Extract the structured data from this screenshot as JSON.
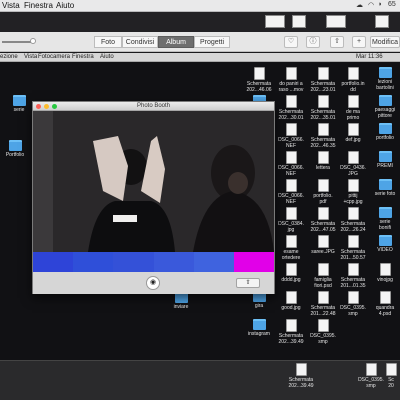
{
  "menubar": {
    "items": [
      "Vista",
      "Finestra",
      "Aiuto"
    ],
    "battery": "65"
  },
  "toolbar": {
    "tabs": [
      "Foto",
      "Condivisi",
      "Album",
      "Progetti"
    ],
    "active_tab": "Album",
    "edit_label": "Modifica"
  },
  "finder_menu": [
    "ezione",
    "Vista",
    "Fotocamera",
    "Finestra",
    "Aiuto"
  ],
  "finder_time": "Mar 11:36",
  "photobooth": {
    "title": "Photo Booth",
    "swatch_colors": [
      "#2e44d8",
      "#2f4fd9",
      "#3451d8",
      "#3a59db",
      "#3f63df",
      "#e100e8"
    ],
    "share_label": "⇧"
  },
  "desktop_left": [
    {
      "label": "serie",
      "type": "folder"
    },
    {
      "label": "Portfolio",
      "type": "folder"
    },
    {
      "label": "inviare",
      "type": "folder"
    }
  ],
  "desktop_items": [
    {
      "label": "Schermata\n202...46.06",
      "type": "file"
    },
    {
      "label": "do paniri a\nraso ...mov",
      "type": "file"
    },
    {
      "label": "Schermata\n202...23.01",
      "type": "file"
    },
    {
      "label": "portfolio.in\ndd",
      "type": "file"
    },
    {
      "label": "lezioni\nbartolini",
      "type": "folder"
    },
    {
      "label": "ARTISTI",
      "type": "folder"
    },
    {
      "label": "Schermata\n202...30.01",
      "type": "file"
    },
    {
      "label": "Schermata\n202...35.01",
      "type": "file"
    },
    {
      "label": "de ma\nprimo",
      "type": "file"
    },
    {
      "label": "paesaggi\npittore",
      "type": "folder"
    },
    {
      "label": "cacciona",
      "type": "folder"
    },
    {
      "label": "DSC_0066.\nNEF",
      "type": "file"
    },
    {
      "label": "Schermata\n202...46.35",
      "type": "file"
    },
    {
      "label": "def.jpg",
      "type": "file"
    },
    {
      "label": "portfolio",
      "type": "folder"
    },
    {
      "label": "capanna",
      "type": "folder"
    },
    {
      "label": "DSC_0066.\nNEF",
      "type": "file"
    },
    {
      "label": "lettera",
      "type": "file"
    },
    {
      "label": "DSC_0436.\nJPG",
      "type": "file"
    },
    {
      "label": "PREMI",
      "type": "folder"
    },
    {
      "label": "concorsi\nrinnovati",
      "type": "folder"
    },
    {
      "label": "DSC_0066.\nNEF",
      "type": "file"
    },
    {
      "label": "portfolio.\npdf",
      "type": "file"
    },
    {
      "label": "pittij\n+cpp.jpg",
      "type": "file"
    },
    {
      "label": "serie foto",
      "type": "folder"
    },
    {
      "label": "da stampare",
      "type": "folder"
    },
    {
      "label": "DSC_0384.\njpg",
      "type": "file"
    },
    {
      "label": "Schermata\n202...47.05",
      "type": "file"
    },
    {
      "label": "Schermata\n202...26.24",
      "type": "file"
    },
    {
      "label": "serie\nbonifi",
      "type": "folder"
    },
    {
      "label": "DESKTOP",
      "type": "folder"
    },
    {
      "label": "esame\nortedere",
      "type": "file"
    },
    {
      "label": "saree.JPG",
      "type": "file"
    },
    {
      "label": "Schermata\n201...50.57",
      "type": "file"
    },
    {
      "label": "VIDEO",
      "type": "folder"
    },
    {
      "label": "foto",
      "type": "folder"
    },
    {
      "label": "dddd.jpg",
      "type": "file"
    },
    {
      "label": "famiglia\nfiori.psd",
      "type": "file"
    },
    {
      "label": "Schermata\n201...01.35",
      "type": "file"
    },
    {
      "label": "vinojpg",
      "type": "file"
    },
    {
      "label": "gira",
      "type": "folder"
    },
    {
      "label": "good.jpg",
      "type": "file"
    },
    {
      "label": "Schermata\n201...22.48",
      "type": "file"
    },
    {
      "label": "DSC_0395.\nsmp",
      "type": "file"
    },
    {
      "label": "quandra\n4.psd",
      "type": "file"
    },
    {
      "label": "instagram",
      "type": "folder"
    },
    {
      "label": "Schermata\n202...39.49",
      "type": "file"
    },
    {
      "label": "DSC_0395.\nsmp",
      "type": "file"
    }
  ],
  "bottom": [
    {
      "label": "Schermata\n202...39.49"
    },
    {
      "label": "DSC_0395.\nsmp"
    },
    {
      "label": "Sc\n20"
    }
  ]
}
